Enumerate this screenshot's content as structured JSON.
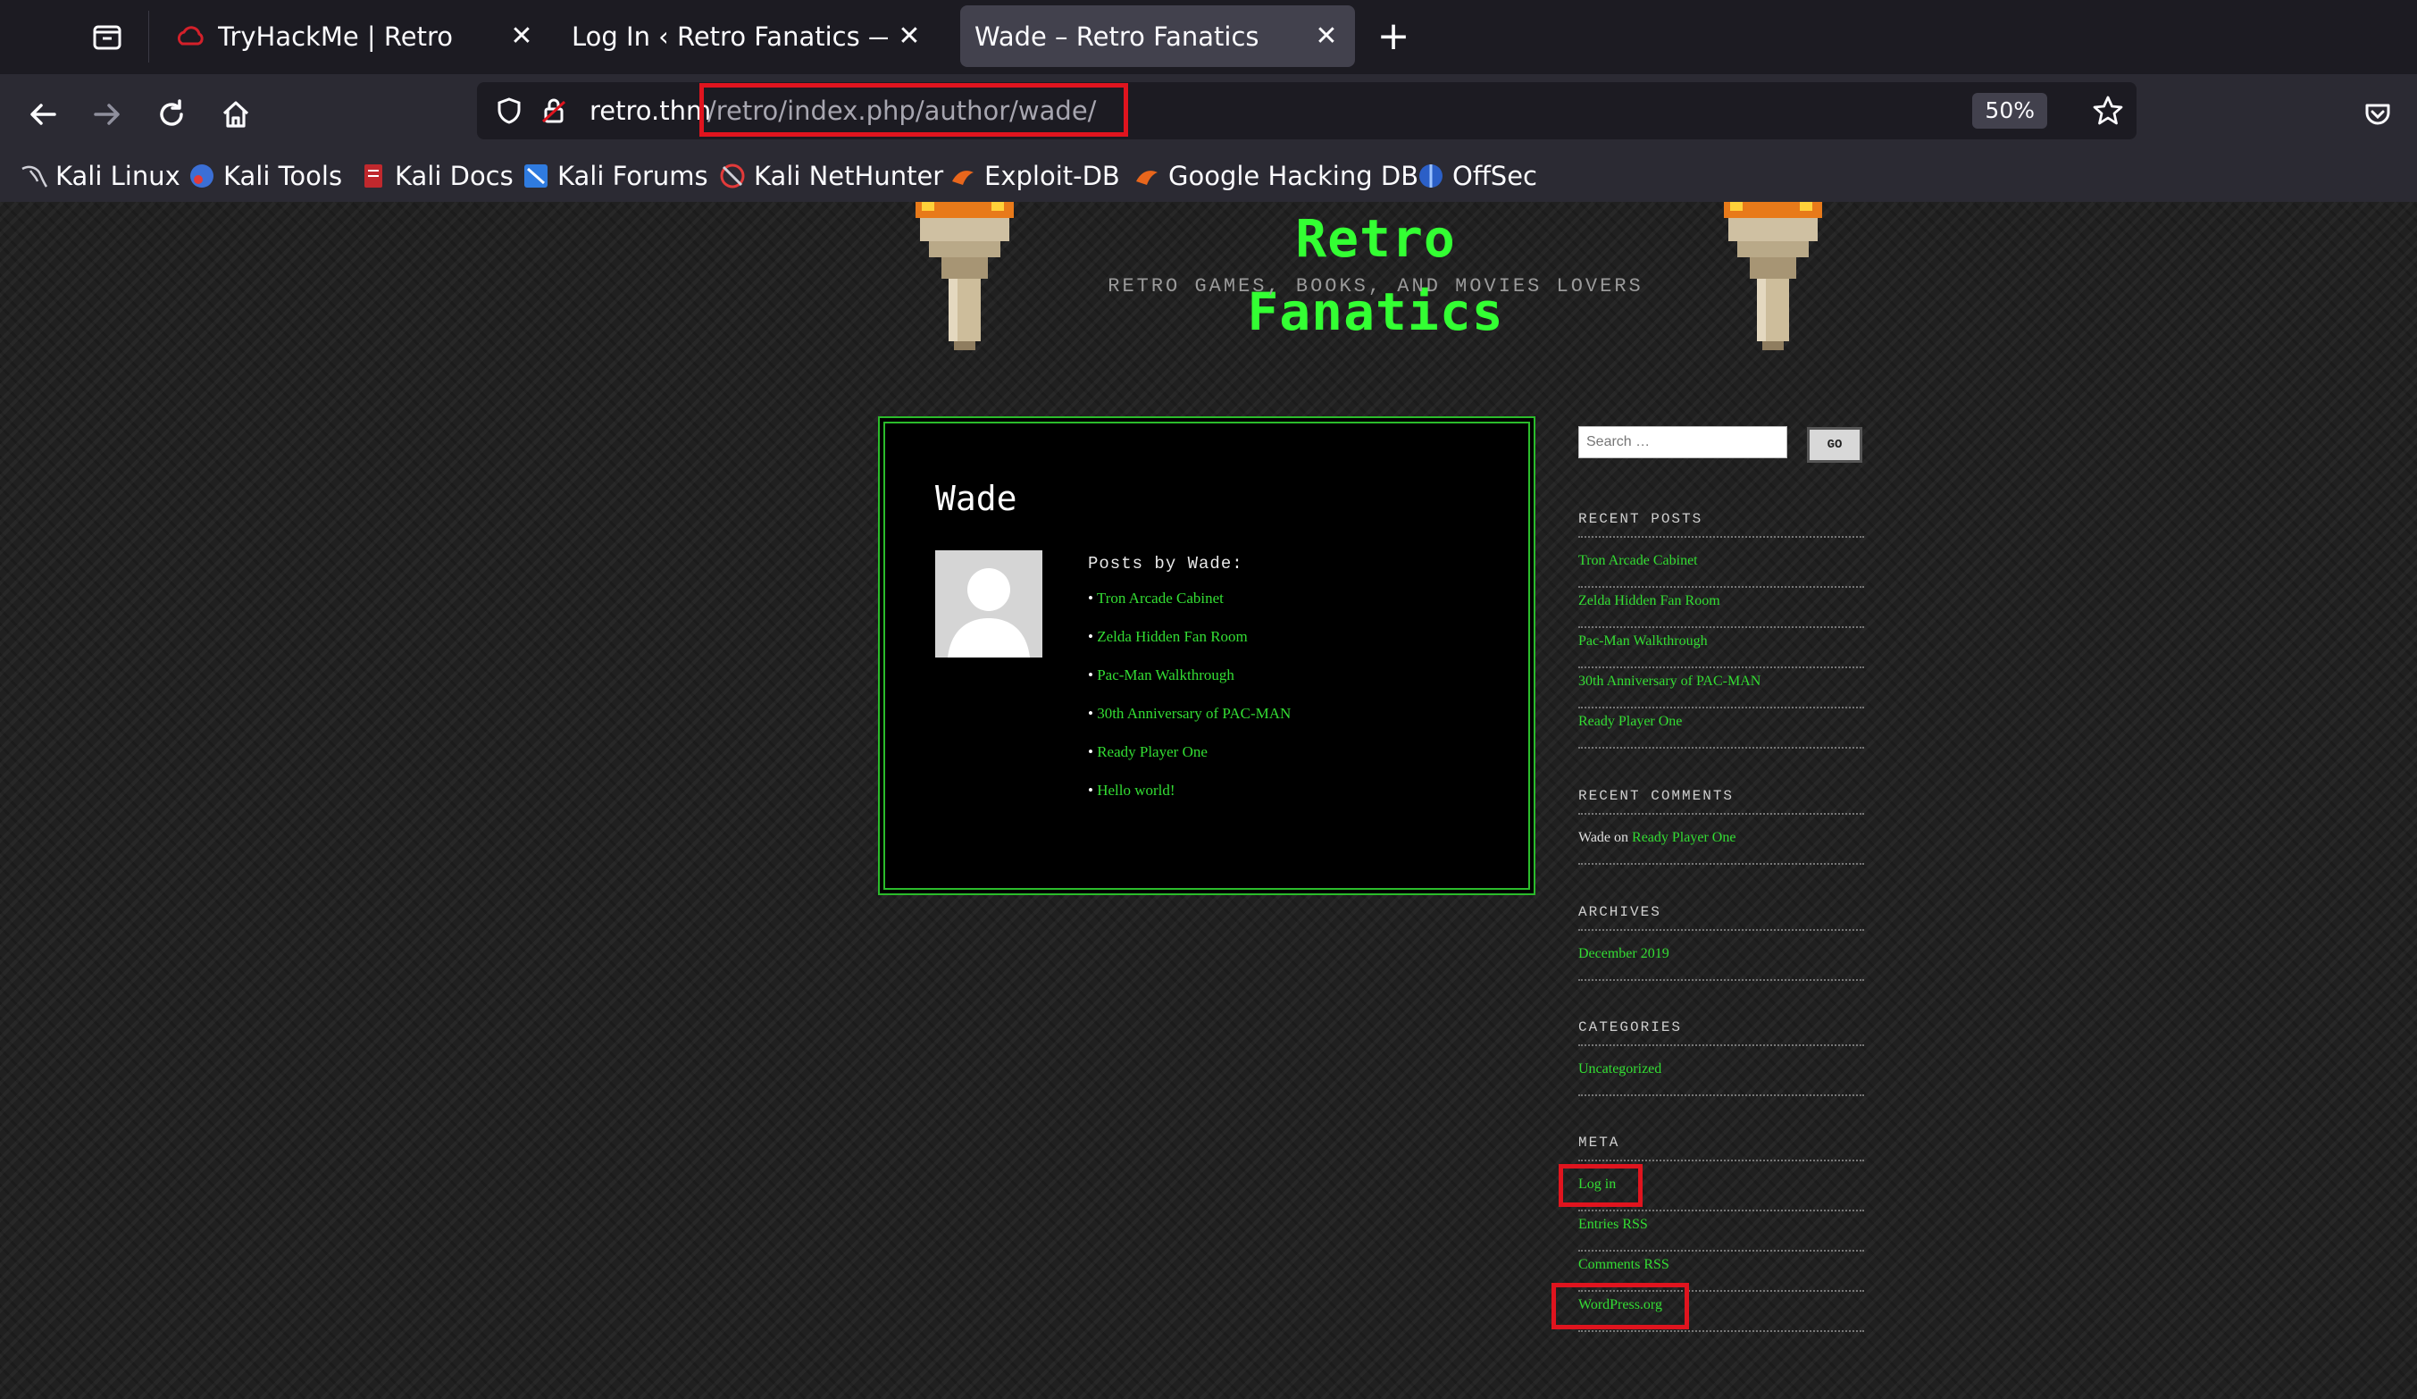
{
  "browser": {
    "tabs": [
      {
        "title": "TryHackMe | Retro",
        "active": false,
        "close": "✕"
      },
      {
        "title": "Log In ‹ Retro Fanatics — WordPress",
        "active": false,
        "close": "✕"
      },
      {
        "title": "Wade – Retro Fanatics",
        "active": true,
        "close": "✕"
      }
    ],
    "new_tab": "+",
    "url_host": "retro.thm",
    "url_path": "/retro/index.php/author/wade/",
    "zoom": "50%",
    "bookmarks": [
      "Kali Linux",
      "Kali Tools",
      "Kali Docs",
      "Kali Forums",
      "Kali NetHunter",
      "Exploit-DB",
      "Google Hacking DB",
      "OffSec"
    ]
  },
  "site": {
    "title": "Retro Fanatics",
    "description": "RETRO GAMES, BOOKS, AND MOVIES LOVERS"
  },
  "author": {
    "name": "Wade",
    "posts_heading": "Posts by Wade:",
    "posts": [
      "Tron Arcade Cabinet",
      "Zelda Hidden Fan Room",
      "Pac-Man Walkthrough",
      "30th Anniversary of PAC-MAN",
      "Ready Player One",
      "Hello world!"
    ]
  },
  "sidebar": {
    "search_placeholder": "Search …",
    "search_button": "GO",
    "recent_posts_title": "RECENT POSTS",
    "recent_posts": [
      "Tron Arcade Cabinet",
      "Zelda Hidden Fan Room",
      "Pac-Man Walkthrough",
      "30th Anniversary of PAC-MAN",
      "Ready Player One"
    ],
    "recent_comments_title": "RECENT COMMENTS",
    "recent_comment": {
      "author": "Wade",
      "on": "on",
      "post": "Ready Player One"
    },
    "archives_title": "ARCHIVES",
    "archives": [
      "December 2019"
    ],
    "categories_title": "CATEGORIES",
    "categories": [
      "Uncategorized"
    ],
    "meta_title": "META",
    "meta": [
      "Log in",
      "Entries RSS",
      "Comments RSS",
      "WordPress.org"
    ]
  },
  "colors": {
    "highlight": "#e0141e",
    "site_green": "#33ff33",
    "link_green": "#33dd33"
  }
}
